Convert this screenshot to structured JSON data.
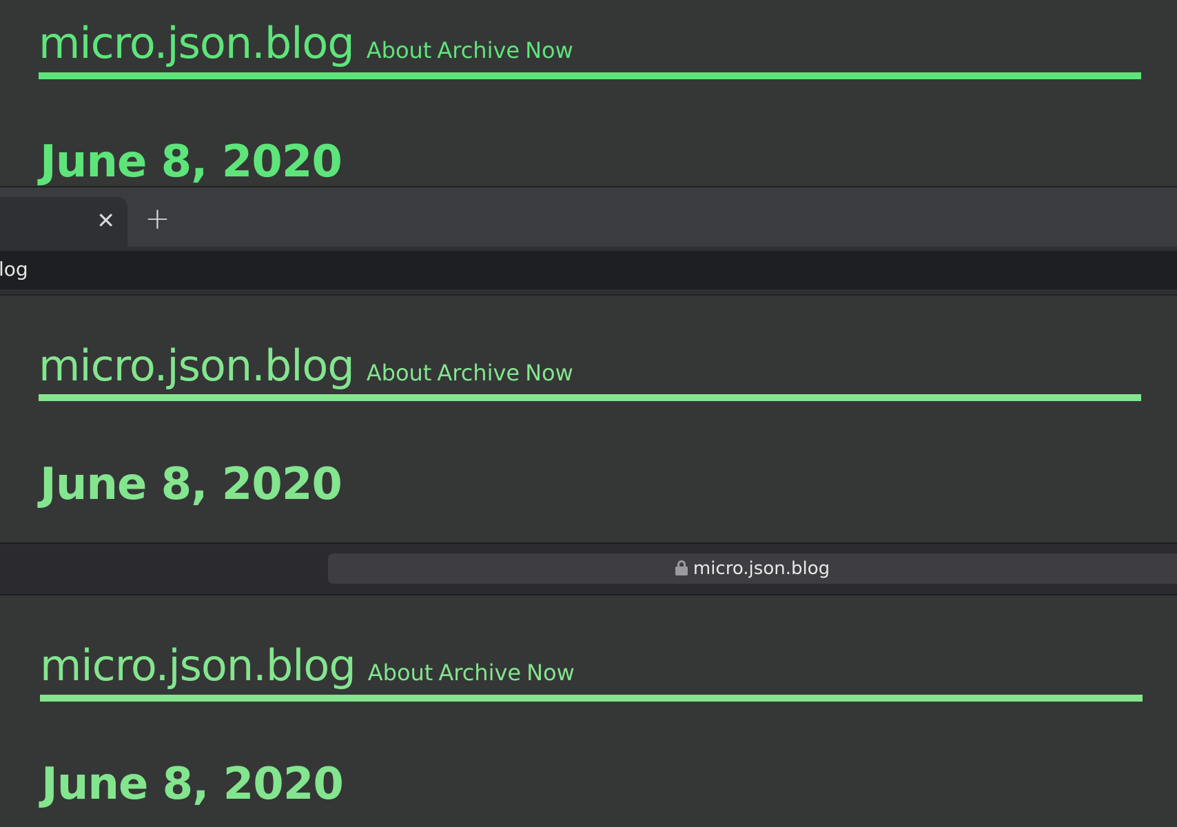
{
  "blog": {
    "title": "micro.json.blog",
    "nav": [
      "About",
      "Archive",
      "Now"
    ],
    "date": "June 8, 2020"
  },
  "browser_tabs": {
    "close_glyph": "✕",
    "new_tab_glyph": "+",
    "address_text": "log"
  },
  "browser_bar": {
    "url": "micro.json.blog"
  },
  "colors": {
    "background": "#353737",
    "accent_bright": "#5ee57a",
    "accent_soft": "#83e58e"
  },
  "icons": [
    "close-icon",
    "plus-icon",
    "lock-icon",
    "reload-icon"
  ]
}
